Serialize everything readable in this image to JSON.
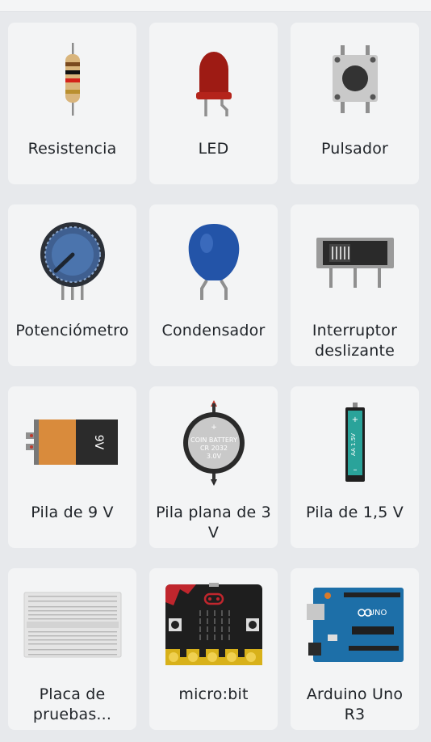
{
  "components": [
    {
      "label": "Resistencia",
      "icon": "resistor-icon"
    },
    {
      "label": "LED",
      "icon": "led-icon"
    },
    {
      "label": "Pulsador",
      "icon": "pushbutton-icon"
    },
    {
      "label": "Potenciómetro",
      "icon": "potentiometer-icon"
    },
    {
      "label": "Condensador",
      "icon": "capacitor-icon"
    },
    {
      "label": "Interruptor deslizante",
      "icon": "slide-switch-icon"
    },
    {
      "label": "Pila de 9 V",
      "icon": "battery-9v-icon",
      "text": "9V"
    },
    {
      "label": "Pila plana de 3 V",
      "icon": "coin-battery-icon",
      "text": [
        "COIN BATTERY",
        "CR 2032",
        "3.0V"
      ]
    },
    {
      "label": "Pila de 1,5 V",
      "icon": "battery-aa-icon",
      "text": "AA 1.5V"
    },
    {
      "label": "Placa de pruebas...",
      "icon": "breadboard-icon"
    },
    {
      "label": "micro:bit",
      "icon": "microbit-icon"
    },
    {
      "label": "Arduino Uno R3",
      "icon": "arduino-uno-icon",
      "text": "UNO"
    }
  ],
  "colors": {
    "background": "#e7e9ec",
    "card": "#f3f4f5",
    "led_red": "#9e1b14",
    "capacitor_blue": "#2354a8",
    "battery_orange": "#d98b3c",
    "coin_battery_silver": "#c9c9c9",
    "aa_battery_teal": "#2aa39a",
    "microbit_black": "#1e1e1e",
    "arduino_blue": "#1d6fa8"
  }
}
